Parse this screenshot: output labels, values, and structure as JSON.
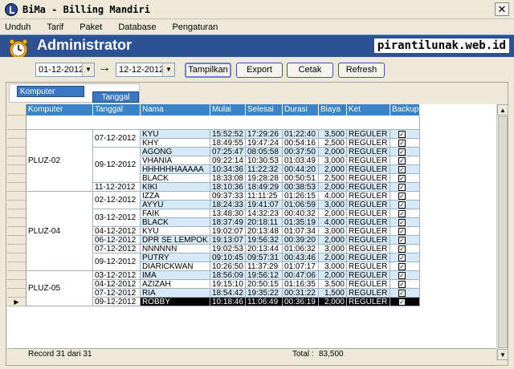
{
  "window": {
    "title": "BiMa - Billing Mandiri",
    "close_glyph": "✕"
  },
  "menu": [
    "Unduh",
    "Tarif",
    "Paket",
    "Database",
    "Pengaturan"
  ],
  "header": {
    "title": "Administrator",
    "site": "pirantilunak.web.id"
  },
  "filter": {
    "date_from": "01-12-2012",
    "date_to": "12-12-2012",
    "arrow": "→",
    "buttons": [
      "Tampilkan",
      "Export",
      "Cetak",
      "Refresh"
    ]
  },
  "grouping": {
    "chips": [
      "Komputer",
      "Tanggal"
    ]
  },
  "columns": [
    "Komputer",
    "Tanggal",
    "Nama",
    "Mulai",
    "Selesai",
    "Durasi",
    "Biaya",
    "Ket",
    "Backup"
  ],
  "groups": [
    {
      "komputer": "PLUZ-02",
      "dates": [
        {
          "tanggal": "07-12-2012",
          "rows": [
            [
              "KYU",
              "15:52:52",
              "17:29:26",
              "01:22:40",
              "3,500",
              "REGULER"
            ],
            [
              "KHY",
              "18:49:55",
              "19:47:24",
              "00:54:16",
              "2,500",
              "REGULER"
            ]
          ]
        },
        {
          "tanggal": "09-12-2012",
          "rows": [
            [
              "AGONG",
              "07:25:47",
              "08:05:58",
              "00:37:50",
              "2,000",
              "REGULER"
            ],
            [
              "VHANIA",
              "09:22:14",
              "10:30:53",
              "01:03:49",
              "3,000",
              "REGULER"
            ],
            [
              "HHHHHHAAAAA",
              "10:34:36",
              "11:22:32",
              "00:44:20",
              "2,000",
              "REGULER"
            ],
            [
              "BLACK",
              "18:33:08",
              "19:28:28",
              "00:50:51",
              "2,500",
              "REGULER"
            ]
          ]
        },
        {
          "tanggal": "11-12-2012",
          "rows": [
            [
              "KIKI",
              "18:10:36",
              "18:49:29",
              "00:38:53",
              "2,000",
              "REGULER"
            ]
          ]
        }
      ]
    },
    {
      "komputer": "PLUZ-04",
      "dates": [
        {
          "tanggal": "02-12-2012",
          "rows": [
            [
              "IZZA",
              "09:37:33",
              "11:11:25",
              "01:26:15",
              "4,000",
              "REGULER"
            ],
            [
              "AYYU",
              "18:24:33",
              "19:41:07",
              "01:06:59",
              "3,000",
              "REGULER"
            ]
          ]
        },
        {
          "tanggal": "03-12-2012",
          "rows": [
            [
              "FAIK",
              "13:48:30",
              "14:32:23",
              "00:40:32",
              "2,000",
              "REGULER"
            ],
            [
              "BLACK",
              "18:37:49",
              "20:18:11",
              "01:35:19",
              "4,000",
              "REGULER"
            ]
          ]
        },
        {
          "tanggal": "04-12-2012",
          "rows": [
            [
              "KYU",
              "19:02:07",
              "20:13:48",
              "01:07:34",
              "3,000",
              "REGULER"
            ]
          ]
        },
        {
          "tanggal": "06-12-2012",
          "rows": [
            [
              "DPR SE LEMPOK",
              "19:13:07",
              "19:56:32",
              "00:39:20",
              "2,000",
              "REGULER"
            ]
          ]
        },
        {
          "tanggal": "07-12-2012",
          "rows": [
            [
              "NNNNNN",
              "19:02:53",
              "20:13:44",
              "01:06:32",
              "3,000",
              "REGULER"
            ]
          ]
        },
        {
          "tanggal": "09-12-2012",
          "rows": [
            [
              "PUTRY",
              "09:10:45",
              "09:57:31",
              "00:43:46",
              "2,000",
              "REGULER"
            ],
            [
              "DIARICKWAN",
              "10:26:50",
              "11:37:29",
              "01:07:17",
              "3,000",
              "REGULER"
            ]
          ]
        }
      ]
    },
    {
      "komputer": "PLUZ-05",
      "dates": [
        {
          "tanggal": "03-12-2012",
          "rows": [
            [
              "IMA",
              "18:56:09",
              "19:56:12",
              "00:47:06",
              "2,000",
              "REGULER"
            ]
          ]
        },
        {
          "tanggal": "04-12-2012",
          "rows": [
            [
              "AZIZAH",
              "19:15:10",
              "20:50:15",
              "01:16:35",
              "3,500",
              "REGULER"
            ]
          ]
        },
        {
          "tanggal": "07-12-2012",
          "rows": [
            [
              "RIA",
              "18:54:42",
              "19:35:22",
              "00:31:22",
              "1,500",
              "REGULER"
            ]
          ]
        },
        {
          "tanggal": "09-12-2012",
          "rows": [
            [
              "ROBBY",
              "10:18:46",
              "11:06:49",
              "00:36:19",
              "2,000",
              "REGULER"
            ]
          ]
        }
      ]
    }
  ],
  "footer": {
    "record": "Record 31 dari 31",
    "total_label": "Total :",
    "total_value": "83,500"
  },
  "colors": {
    "header_bar": "#2c5294",
    "grid_header": "#3a83c7",
    "row_alt": "#d6e9f7",
    "selected": "#000000"
  }
}
